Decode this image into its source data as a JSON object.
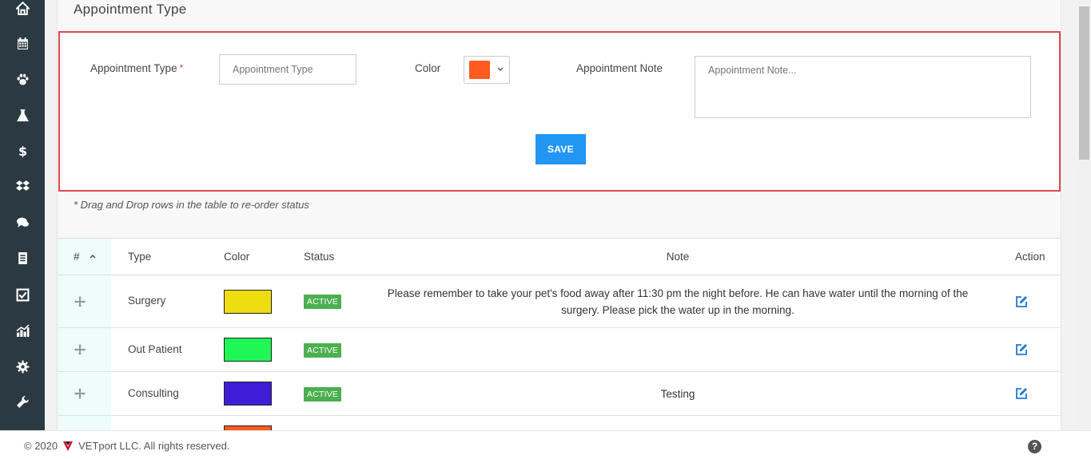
{
  "sidebar": {
    "items": [
      {
        "icon": "home-icon"
      },
      {
        "icon": "calendar-icon"
      },
      {
        "icon": "paw-icon"
      },
      {
        "icon": "flask-icon"
      },
      {
        "icon": "dollar-icon"
      },
      {
        "icon": "dropbox-icon"
      },
      {
        "icon": "chat-icon"
      },
      {
        "icon": "receipt-icon"
      },
      {
        "icon": "checkbox-icon"
      },
      {
        "icon": "bar-chart-icon"
      },
      {
        "icon": "gear-icon"
      },
      {
        "icon": "wrench-icon"
      }
    ]
  },
  "page": {
    "title": "Appointment Type"
  },
  "form": {
    "type_label": "Appointment Type",
    "required_mark": "*",
    "type_placeholder": "Appointment Type",
    "color_label": "Color",
    "color_value": "#ff5a1f",
    "note_label": "Appointment Note",
    "note_placeholder": "Appointment Note...",
    "save_label": "SAVE"
  },
  "hint": "* Drag and Drop rows in the table to re-order status",
  "table": {
    "headers": {
      "index": "#",
      "type": "Type",
      "color": "Color",
      "status": "Status",
      "note": "Note",
      "action": "Action"
    },
    "rows": [
      {
        "type": "Surgery",
        "color": "#eedd11",
        "status": "ACTIVE",
        "note": "Please remember to take your pet's food away after 11:30 pm the night before. He can have water until the morning of the surgery. Please pick the water up in the morning."
      },
      {
        "type": "Out Patient",
        "color": "#1ef755",
        "status": "ACTIVE",
        "note": ""
      },
      {
        "type": "Consulting",
        "color": "#3d1ed6",
        "status": "ACTIVE",
        "note": "Testing"
      },
      {
        "type": "",
        "color": "#ff5a1f",
        "status": "",
        "note": ""
      }
    ]
  },
  "footer": {
    "copyright": "© 2020",
    "company": "VETport LLC. All rights reserved.",
    "help": "?"
  }
}
